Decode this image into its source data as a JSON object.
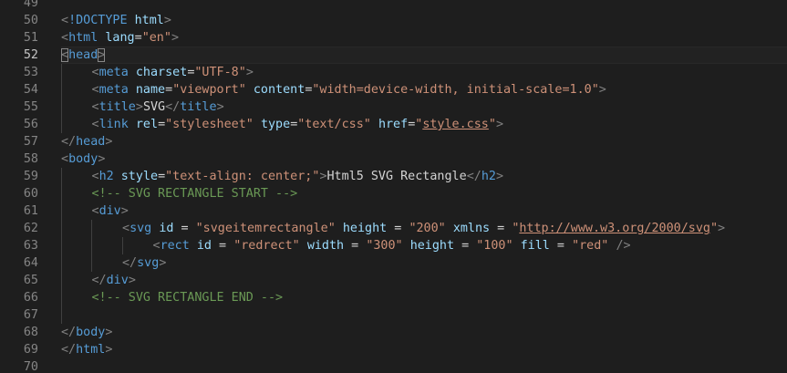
{
  "editor": {
    "language": "html",
    "colors": {
      "background": "#1e1e1e",
      "line_number": "#858585",
      "tag": "#569cd6",
      "punctuation": "#808080",
      "attribute": "#9cdcfe",
      "string": "#ce9178",
      "text": "#d4d4d4",
      "comment": "#6a9955"
    },
    "current_line": "52",
    "lines": [
      {
        "n": "49",
        "indent": 0,
        "tokens": []
      },
      {
        "n": "50",
        "indent": 0,
        "tokens": [
          {
            "t": "punc",
            "v": "<"
          },
          {
            "t": "tag",
            "v": "!DOCTYPE"
          },
          {
            "t": "txt",
            "v": " "
          },
          {
            "t": "attr",
            "v": "html"
          },
          {
            "t": "punc",
            "v": ">"
          }
        ]
      },
      {
        "n": "51",
        "indent": 0,
        "tokens": [
          {
            "t": "punc",
            "v": "<"
          },
          {
            "t": "tag",
            "v": "html"
          },
          {
            "t": "txt",
            "v": " "
          },
          {
            "t": "attr",
            "v": "lang"
          },
          {
            "t": "txt",
            "v": "="
          },
          {
            "t": "str",
            "v": "\"en\""
          },
          {
            "t": "punc",
            "v": ">"
          }
        ]
      },
      {
        "n": "52",
        "indent": 0,
        "tokens": [
          {
            "t": "punc",
            "v": "<",
            "match": true
          },
          {
            "t": "tag",
            "v": "head"
          },
          {
            "t": "punc",
            "v": ">",
            "match": true
          }
        ]
      },
      {
        "n": "53",
        "indent": 1,
        "tokens": [
          {
            "t": "punc",
            "v": "<"
          },
          {
            "t": "tag",
            "v": "meta"
          },
          {
            "t": "txt",
            "v": " "
          },
          {
            "t": "attr",
            "v": "charset"
          },
          {
            "t": "txt",
            "v": "="
          },
          {
            "t": "str",
            "v": "\"UTF-8\""
          },
          {
            "t": "punc",
            "v": ">"
          }
        ]
      },
      {
        "n": "54",
        "indent": 1,
        "tokens": [
          {
            "t": "punc",
            "v": "<"
          },
          {
            "t": "tag",
            "v": "meta"
          },
          {
            "t": "txt",
            "v": " "
          },
          {
            "t": "attr",
            "v": "name"
          },
          {
            "t": "txt",
            "v": "="
          },
          {
            "t": "str",
            "v": "\"viewport\""
          },
          {
            "t": "txt",
            "v": " "
          },
          {
            "t": "attr",
            "v": "content"
          },
          {
            "t": "txt",
            "v": "="
          },
          {
            "t": "str",
            "v": "\"width=device-width, initial-scale=1.0\""
          },
          {
            "t": "punc",
            "v": ">"
          }
        ]
      },
      {
        "n": "55",
        "indent": 1,
        "tokens": [
          {
            "t": "punc",
            "v": "<"
          },
          {
            "t": "tag",
            "v": "title"
          },
          {
            "t": "punc",
            "v": ">"
          },
          {
            "t": "txt",
            "v": "SVG"
          },
          {
            "t": "punc",
            "v": "</"
          },
          {
            "t": "tag",
            "v": "title"
          },
          {
            "t": "punc",
            "v": ">"
          }
        ]
      },
      {
        "n": "56",
        "indent": 1,
        "tokens": [
          {
            "t": "punc",
            "v": "<"
          },
          {
            "t": "tag",
            "v": "link"
          },
          {
            "t": "txt",
            "v": " "
          },
          {
            "t": "attr",
            "v": "rel"
          },
          {
            "t": "txt",
            "v": "="
          },
          {
            "t": "str",
            "v": "\"stylesheet\""
          },
          {
            "t": "txt",
            "v": " "
          },
          {
            "t": "attr",
            "v": "type"
          },
          {
            "t": "txt",
            "v": "="
          },
          {
            "t": "str",
            "v": "\"text/css\""
          },
          {
            "t": "txt",
            "v": " "
          },
          {
            "t": "attr",
            "v": "href"
          },
          {
            "t": "txt",
            "v": "="
          },
          {
            "t": "str",
            "v": "\""
          },
          {
            "t": "str",
            "v": "style.css",
            "link": true
          },
          {
            "t": "str",
            "v": "\""
          },
          {
            "t": "punc",
            "v": ">"
          }
        ]
      },
      {
        "n": "57",
        "indent": 0,
        "tokens": [
          {
            "t": "punc",
            "v": "</"
          },
          {
            "t": "tag",
            "v": "head"
          },
          {
            "t": "punc",
            "v": ">"
          }
        ]
      },
      {
        "n": "58",
        "indent": 0,
        "tokens": [
          {
            "t": "punc",
            "v": "<"
          },
          {
            "t": "tag",
            "v": "body"
          },
          {
            "t": "punc",
            "v": ">"
          }
        ]
      },
      {
        "n": "59",
        "indent": 1,
        "tokens": [
          {
            "t": "punc",
            "v": "<"
          },
          {
            "t": "tag",
            "v": "h2"
          },
          {
            "t": "txt",
            "v": " "
          },
          {
            "t": "attr",
            "v": "style"
          },
          {
            "t": "txt",
            "v": "="
          },
          {
            "t": "str",
            "v": "\"text-align: center;\""
          },
          {
            "t": "punc",
            "v": ">"
          },
          {
            "t": "txt",
            "v": "Html5 SVG Rectangle"
          },
          {
            "t": "punc",
            "v": "</"
          },
          {
            "t": "tag",
            "v": "h2"
          },
          {
            "t": "punc",
            "v": ">"
          }
        ]
      },
      {
        "n": "60",
        "indent": 1,
        "tokens": [
          {
            "t": "com",
            "v": "<!-- SVG RECTANGLE START -->"
          }
        ]
      },
      {
        "n": "61",
        "indent": 1,
        "tokens": [
          {
            "t": "punc",
            "v": "<"
          },
          {
            "t": "tag",
            "v": "div"
          },
          {
            "t": "punc",
            "v": ">"
          }
        ]
      },
      {
        "n": "62",
        "indent": 2,
        "tokens": [
          {
            "t": "punc",
            "v": "<"
          },
          {
            "t": "tag",
            "v": "svg"
          },
          {
            "t": "txt",
            "v": " "
          },
          {
            "t": "attr",
            "v": "id"
          },
          {
            "t": "txt",
            "v": " = "
          },
          {
            "t": "str",
            "v": "\"svgeitemrectangle\""
          },
          {
            "t": "txt",
            "v": " "
          },
          {
            "t": "attr",
            "v": "height"
          },
          {
            "t": "txt",
            "v": " = "
          },
          {
            "t": "str",
            "v": "\"200\""
          },
          {
            "t": "txt",
            "v": " "
          },
          {
            "t": "attr",
            "v": "xmlns"
          },
          {
            "t": "txt",
            "v": " = "
          },
          {
            "t": "str",
            "v": "\""
          },
          {
            "t": "str",
            "v": "http://www.w3.org/2000/svg",
            "link": true
          },
          {
            "t": "str",
            "v": "\""
          },
          {
            "t": "punc",
            "v": ">"
          }
        ]
      },
      {
        "n": "63",
        "indent": 3,
        "tokens": [
          {
            "t": "punc",
            "v": "<"
          },
          {
            "t": "tag",
            "v": "rect"
          },
          {
            "t": "txt",
            "v": " "
          },
          {
            "t": "attr",
            "v": "id"
          },
          {
            "t": "txt",
            "v": " = "
          },
          {
            "t": "str",
            "v": "\"redrect\""
          },
          {
            "t": "txt",
            "v": " "
          },
          {
            "t": "attr",
            "v": "width"
          },
          {
            "t": "txt",
            "v": " = "
          },
          {
            "t": "str",
            "v": "\"300\""
          },
          {
            "t": "txt",
            "v": " "
          },
          {
            "t": "attr",
            "v": "height"
          },
          {
            "t": "txt",
            "v": " = "
          },
          {
            "t": "str",
            "v": "\"100\""
          },
          {
            "t": "txt",
            "v": " "
          },
          {
            "t": "attr",
            "v": "fill"
          },
          {
            "t": "txt",
            "v": " = "
          },
          {
            "t": "str",
            "v": "\"red\""
          },
          {
            "t": "txt",
            "v": " "
          },
          {
            "t": "punc",
            "v": "/>"
          }
        ]
      },
      {
        "n": "64",
        "indent": 2,
        "tokens": [
          {
            "t": "punc",
            "v": "</"
          },
          {
            "t": "tag",
            "v": "svg"
          },
          {
            "t": "punc",
            "v": ">"
          }
        ]
      },
      {
        "n": "65",
        "indent": 1,
        "tokens": [
          {
            "t": "punc",
            "v": "</"
          },
          {
            "t": "tag",
            "v": "div"
          },
          {
            "t": "punc",
            "v": ">"
          }
        ]
      },
      {
        "n": "66",
        "indent": 1,
        "tokens": [
          {
            "t": "com",
            "v": "<!-- SVG RECTANGLE END -->"
          }
        ]
      },
      {
        "n": "67",
        "indent": 0,
        "tokens": []
      },
      {
        "n": "68",
        "indent": 0,
        "tokens": [
          {
            "t": "punc",
            "v": "</"
          },
          {
            "t": "tag",
            "v": "body"
          },
          {
            "t": "punc",
            "v": ">"
          }
        ]
      },
      {
        "n": "69",
        "indent": 0,
        "tokens": [
          {
            "t": "punc",
            "v": "</"
          },
          {
            "t": "tag",
            "v": "html"
          },
          {
            "t": "punc",
            "v": ">"
          }
        ]
      },
      {
        "n": "70",
        "indent": 0,
        "tokens": []
      }
    ]
  }
}
